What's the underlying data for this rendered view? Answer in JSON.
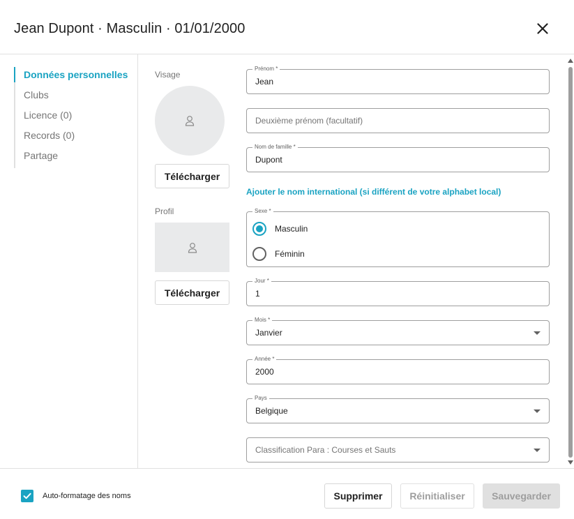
{
  "header": {
    "title": "Jean Dupont · Masculin · 01/01/2000",
    "close_icon": "close-icon"
  },
  "nav": {
    "items": [
      {
        "label": "Données personnelles",
        "active": true
      },
      {
        "label": "Clubs",
        "active": false
      },
      {
        "label": "Licence (0)",
        "active": false
      },
      {
        "label": "Records (0)",
        "active": false
      },
      {
        "label": "Partage",
        "active": false
      }
    ]
  },
  "media": {
    "face_label": "Visage",
    "profile_label": "Profil",
    "upload_label": "Télécharger",
    "placeholder_icon": "person-icon"
  },
  "form": {
    "first_name": {
      "label": "Prénom *",
      "value": "Jean"
    },
    "middle_name": {
      "placeholder": "Deuxième prénom (facultatif)"
    },
    "last_name": {
      "label": "Nom de famille *",
      "value": "Dupont"
    },
    "international_link": "Ajouter le nom international (si différent de votre alphabet local)",
    "sex": {
      "label": "Sexe *",
      "options": [
        {
          "label": "Masculin",
          "checked": true
        },
        {
          "label": "Féminin",
          "checked": false
        }
      ]
    },
    "day": {
      "label": "Jour *",
      "value": "1"
    },
    "month": {
      "label": "Mois *",
      "value": "Janvier"
    },
    "year": {
      "label": "Année *",
      "value": "2000"
    },
    "country": {
      "label": "Pays",
      "value": "Belgique"
    },
    "classification": {
      "placeholder": "Classification Para : Courses et Sauts"
    }
  },
  "footer": {
    "auto_format_label": "Auto-formatage des noms",
    "auto_format_checked": true,
    "delete_label": "Supprimer",
    "reset_label": "Réinitialiser",
    "save_label": "Sauvegarder"
  },
  "colors": {
    "accent": "#1aa3c2",
    "border": "#9e9e9e",
    "disabled_bg": "#e0e0e0",
    "disabled_text": "#9e9e9e"
  }
}
